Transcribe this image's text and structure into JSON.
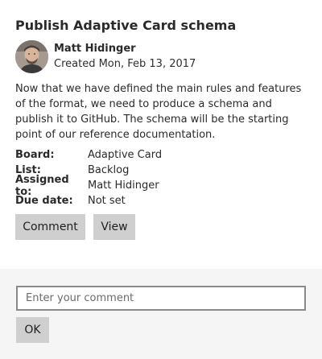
{
  "card": {
    "title": "Publish Adaptive Card schema",
    "author": {
      "name": "Matt Hidinger",
      "created": "Created Mon, Feb 13, 2017",
      "avatar_icon": "person-avatar"
    },
    "description": "Now that we have defined the main rules and features of the format, we need to produce a schema and publish it to GitHub. The schema will be the starting point of our reference documentation.",
    "facts": [
      {
        "key": "Board:",
        "value": "Adaptive Card"
      },
      {
        "key": "List:",
        "value": "Backlog"
      },
      {
        "key": "Assigned to:",
        "value": "Matt Hidinger"
      },
      {
        "key": "Due date:",
        "value": "Not set"
      }
    ],
    "actions": {
      "comment_label": "Comment",
      "view_label": "View"
    }
  },
  "comment_panel": {
    "input_value": "",
    "input_placeholder": "Enter your comment",
    "ok_label": "OK"
  },
  "colors": {
    "button_bg": "#cfcfcf",
    "panel_bg": "#f5f5f5",
    "input_border": "#8a8a8a"
  }
}
